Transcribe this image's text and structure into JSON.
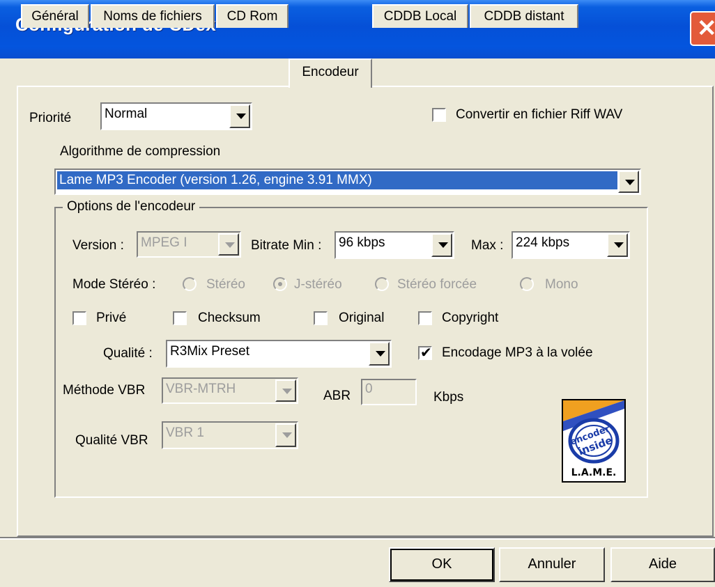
{
  "window": {
    "title": "Configuration de CDex"
  },
  "tabs": [
    {
      "label": "Général"
    },
    {
      "label": "Noms de fichiers"
    },
    {
      "label": "CD Rom"
    },
    {
      "label": "Encodeur"
    },
    {
      "label": "CDDB Local"
    },
    {
      "label": "CDDB distant"
    }
  ],
  "encoder": {
    "priority_label": "Priorité",
    "priority_value": "Normal",
    "riff_label": "Convertir en fichier Riff WAV",
    "algo_label": "Algorithme de compression",
    "algo_value": "Lame MP3 Encoder (version 1.26, engine 3.91 MMX)",
    "group_title": "Options de l'encodeur",
    "version_label": "Version :",
    "version_value": "MPEG I",
    "bitrate_min_label": "Bitrate Min :",
    "bitrate_min_value": "96 kbps",
    "max_label": "Max :",
    "max_value": "224 kbps",
    "stereo_label": "Mode Stéréo :",
    "stereo_options": [
      "Stéréo",
      "J-stéréo",
      "Stéréo forcée",
      "Mono"
    ],
    "checks": [
      "Privé",
      "Checksum",
      "Original",
      "Copyright"
    ],
    "quality_label": "Qualité :",
    "quality_value": "R3Mix Preset",
    "onthefly_label": "Encodage MP3 à la volée",
    "vbr_method_label": "Méthode VBR",
    "vbr_method_value": "VBR-MTRH",
    "abr_label": "ABR",
    "abr_value": "0",
    "kbps_label": "Kbps",
    "vbr_quality_label": "Qualité VBR",
    "vbr_quality_value": "VBR 1",
    "logo": {
      "line1": "encoder",
      "line2": "inside",
      "footer": "L.A.M.E."
    }
  },
  "buttons": {
    "ok": "OK",
    "cancel": "Annuler",
    "help": "Aide"
  },
  "colors": {
    "title_bar": "#0550d7",
    "selection": "#316ac5",
    "face": "#ece9d8"
  }
}
